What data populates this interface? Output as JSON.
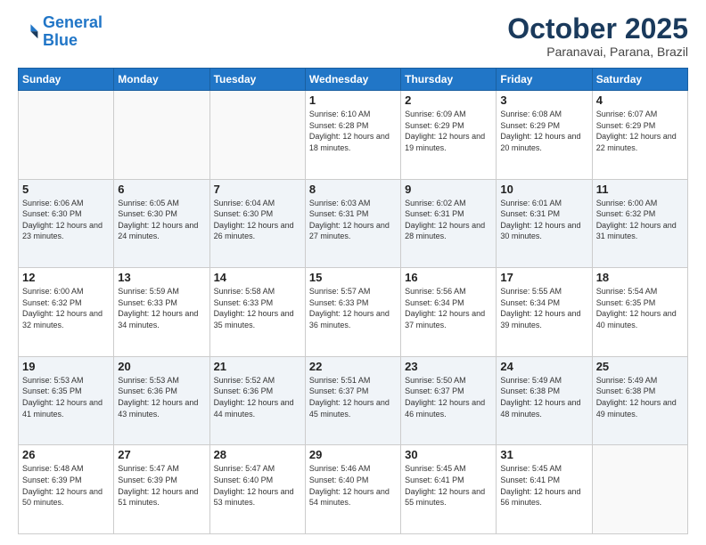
{
  "header": {
    "logo_line1": "General",
    "logo_line2": "Blue",
    "month_year": "October 2025",
    "location": "Paranavai, Parana, Brazil"
  },
  "weekdays": [
    "Sunday",
    "Monday",
    "Tuesday",
    "Wednesday",
    "Thursday",
    "Friday",
    "Saturday"
  ],
  "weeks": [
    [
      {
        "day": "",
        "sunrise": "",
        "sunset": "",
        "daylight": ""
      },
      {
        "day": "",
        "sunrise": "",
        "sunset": "",
        "daylight": ""
      },
      {
        "day": "",
        "sunrise": "",
        "sunset": "",
        "daylight": ""
      },
      {
        "day": "1",
        "sunrise": "Sunrise: 6:10 AM",
        "sunset": "Sunset: 6:28 PM",
        "daylight": "Daylight: 12 hours and 18 minutes."
      },
      {
        "day": "2",
        "sunrise": "Sunrise: 6:09 AM",
        "sunset": "Sunset: 6:29 PM",
        "daylight": "Daylight: 12 hours and 19 minutes."
      },
      {
        "day": "3",
        "sunrise": "Sunrise: 6:08 AM",
        "sunset": "Sunset: 6:29 PM",
        "daylight": "Daylight: 12 hours and 20 minutes."
      },
      {
        "day": "4",
        "sunrise": "Sunrise: 6:07 AM",
        "sunset": "Sunset: 6:29 PM",
        "daylight": "Daylight: 12 hours and 22 minutes."
      }
    ],
    [
      {
        "day": "5",
        "sunrise": "Sunrise: 6:06 AM",
        "sunset": "Sunset: 6:30 PM",
        "daylight": "Daylight: 12 hours and 23 minutes."
      },
      {
        "day": "6",
        "sunrise": "Sunrise: 6:05 AM",
        "sunset": "Sunset: 6:30 PM",
        "daylight": "Daylight: 12 hours and 24 minutes."
      },
      {
        "day": "7",
        "sunrise": "Sunrise: 6:04 AM",
        "sunset": "Sunset: 6:30 PM",
        "daylight": "Daylight: 12 hours and 26 minutes."
      },
      {
        "day": "8",
        "sunrise": "Sunrise: 6:03 AM",
        "sunset": "Sunset: 6:31 PM",
        "daylight": "Daylight: 12 hours and 27 minutes."
      },
      {
        "day": "9",
        "sunrise": "Sunrise: 6:02 AM",
        "sunset": "Sunset: 6:31 PM",
        "daylight": "Daylight: 12 hours and 28 minutes."
      },
      {
        "day": "10",
        "sunrise": "Sunrise: 6:01 AM",
        "sunset": "Sunset: 6:31 PM",
        "daylight": "Daylight: 12 hours and 30 minutes."
      },
      {
        "day": "11",
        "sunrise": "Sunrise: 6:00 AM",
        "sunset": "Sunset: 6:32 PM",
        "daylight": "Daylight: 12 hours and 31 minutes."
      }
    ],
    [
      {
        "day": "12",
        "sunrise": "Sunrise: 6:00 AM",
        "sunset": "Sunset: 6:32 PM",
        "daylight": "Daylight: 12 hours and 32 minutes."
      },
      {
        "day": "13",
        "sunrise": "Sunrise: 5:59 AM",
        "sunset": "Sunset: 6:33 PM",
        "daylight": "Daylight: 12 hours and 34 minutes."
      },
      {
        "day": "14",
        "sunrise": "Sunrise: 5:58 AM",
        "sunset": "Sunset: 6:33 PM",
        "daylight": "Daylight: 12 hours and 35 minutes."
      },
      {
        "day": "15",
        "sunrise": "Sunrise: 5:57 AM",
        "sunset": "Sunset: 6:33 PM",
        "daylight": "Daylight: 12 hours and 36 minutes."
      },
      {
        "day": "16",
        "sunrise": "Sunrise: 5:56 AM",
        "sunset": "Sunset: 6:34 PM",
        "daylight": "Daylight: 12 hours and 37 minutes."
      },
      {
        "day": "17",
        "sunrise": "Sunrise: 5:55 AM",
        "sunset": "Sunset: 6:34 PM",
        "daylight": "Daylight: 12 hours and 39 minutes."
      },
      {
        "day": "18",
        "sunrise": "Sunrise: 5:54 AM",
        "sunset": "Sunset: 6:35 PM",
        "daylight": "Daylight: 12 hours and 40 minutes."
      }
    ],
    [
      {
        "day": "19",
        "sunrise": "Sunrise: 5:53 AM",
        "sunset": "Sunset: 6:35 PM",
        "daylight": "Daylight: 12 hours and 41 minutes."
      },
      {
        "day": "20",
        "sunrise": "Sunrise: 5:53 AM",
        "sunset": "Sunset: 6:36 PM",
        "daylight": "Daylight: 12 hours and 43 minutes."
      },
      {
        "day": "21",
        "sunrise": "Sunrise: 5:52 AM",
        "sunset": "Sunset: 6:36 PM",
        "daylight": "Daylight: 12 hours and 44 minutes."
      },
      {
        "day": "22",
        "sunrise": "Sunrise: 5:51 AM",
        "sunset": "Sunset: 6:37 PM",
        "daylight": "Daylight: 12 hours and 45 minutes."
      },
      {
        "day": "23",
        "sunrise": "Sunrise: 5:50 AM",
        "sunset": "Sunset: 6:37 PM",
        "daylight": "Daylight: 12 hours and 46 minutes."
      },
      {
        "day": "24",
        "sunrise": "Sunrise: 5:49 AM",
        "sunset": "Sunset: 6:38 PM",
        "daylight": "Daylight: 12 hours and 48 minutes."
      },
      {
        "day": "25",
        "sunrise": "Sunrise: 5:49 AM",
        "sunset": "Sunset: 6:38 PM",
        "daylight": "Daylight: 12 hours and 49 minutes."
      }
    ],
    [
      {
        "day": "26",
        "sunrise": "Sunrise: 5:48 AM",
        "sunset": "Sunset: 6:39 PM",
        "daylight": "Daylight: 12 hours and 50 minutes."
      },
      {
        "day": "27",
        "sunrise": "Sunrise: 5:47 AM",
        "sunset": "Sunset: 6:39 PM",
        "daylight": "Daylight: 12 hours and 51 minutes."
      },
      {
        "day": "28",
        "sunrise": "Sunrise: 5:47 AM",
        "sunset": "Sunset: 6:40 PM",
        "daylight": "Daylight: 12 hours and 53 minutes."
      },
      {
        "day": "29",
        "sunrise": "Sunrise: 5:46 AM",
        "sunset": "Sunset: 6:40 PM",
        "daylight": "Daylight: 12 hours and 54 minutes."
      },
      {
        "day": "30",
        "sunrise": "Sunrise: 5:45 AM",
        "sunset": "Sunset: 6:41 PM",
        "daylight": "Daylight: 12 hours and 55 minutes."
      },
      {
        "day": "31",
        "sunrise": "Sunrise: 5:45 AM",
        "sunset": "Sunset: 6:41 PM",
        "daylight": "Daylight: 12 hours and 56 minutes."
      },
      {
        "day": "",
        "sunrise": "",
        "sunset": "",
        "daylight": ""
      }
    ]
  ]
}
